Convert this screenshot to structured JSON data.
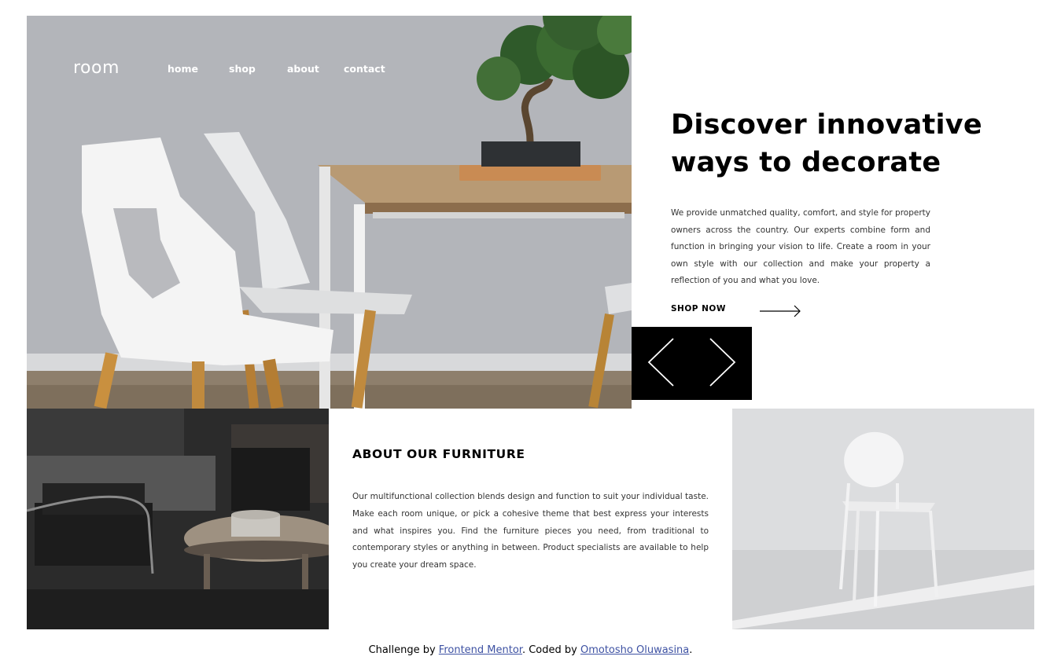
{
  "nav": {
    "logo": "room",
    "links": [
      "home",
      "shop",
      "about",
      "contact"
    ]
  },
  "hero": {
    "title_line1": "Discover innovative",
    "title_line2": "ways to decorate",
    "description": "We provide unmatched quality, comfort, and style for property owners across the country. Our experts combine form and function in bringing your vision to life. Create a room in your own style with our collection and make your property a reflection of you and what you love.",
    "cta_label": "SHOP NOW",
    "cta_icon": "long-arrow-right-icon"
  },
  "slider": {
    "prev_icon": "angle-left-icon",
    "next_icon": "angle-right-icon"
  },
  "about": {
    "title": "ABOUT OUR FURNITURE",
    "description": "Our multifunctional collection blends design and function to suit your individual taste. Make each room unique, or pick a cohesive theme that best express your interests and what inspires you. Find the furniture pieces you need, from traditional to contemporary styles or anything in between. Product specialists are available to help you create your dream space."
  },
  "attribution": {
    "prefix": "Challenge by",
    "challenge_link": "Frontend Mentor",
    "middle": ". Coded by",
    "author_link": "Omotosho Oluwasina",
    "suffix": "."
  },
  "colors": {
    "background": "#ffffff",
    "slider_bg": "#000000",
    "link": "#3e52a3",
    "text": "#000000"
  }
}
